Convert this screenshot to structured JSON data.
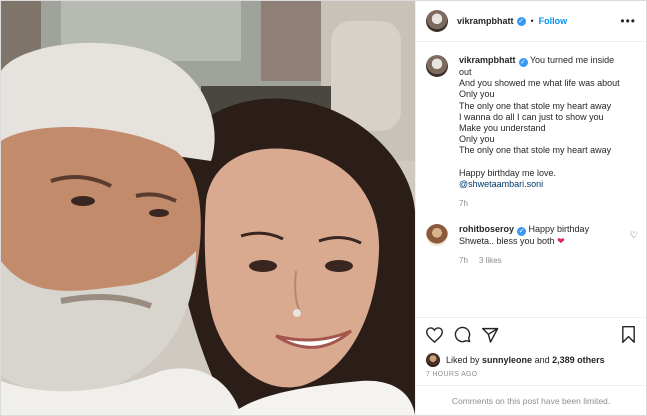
{
  "post": {
    "author": "vikrampbhatt",
    "follow_label": "Follow",
    "caption_lines": [
      "You turned me inside",
      "out",
      "And you showed me what life was about",
      "Only you",
      "The only one that stole my heart away",
      "I wanna do all I can just to show you",
      "Make you understand",
      "Only you",
      "The only one that stole my heart away",
      "",
      "Happy birthday me love."
    ],
    "caption_mention": "@shwetaambari.soni",
    "caption_time": "7h"
  },
  "comments": [
    {
      "user": "rohitboseroy",
      "text_line1": "Happy birthday",
      "text_line2": "Shweta.. bless you both",
      "time": "7h",
      "likes": "3 likes"
    }
  ],
  "likes": {
    "prefix": "Liked by",
    "user": "sunnyleone",
    "joiner": "and",
    "others": "2,389 others"
  },
  "timestamp": "7 HOURS AGO",
  "comments_limited": "Comments on this post have been limited.",
  "icons": {
    "more": "more-horizontal-icon",
    "like": "heart-outline-icon",
    "comment": "comment-icon",
    "share": "share-icon",
    "save": "bookmark-icon",
    "verified": "verified-badge-icon",
    "comment_like": "heart-outline-icon",
    "emoji": "red-heart-emoji-icon"
  },
  "colors": {
    "accent": "#0095f6",
    "verified": "#3897f0",
    "secondary_text": "#8e8e8e",
    "mention": "#00376b",
    "emoji_heart": "#e0245e"
  }
}
